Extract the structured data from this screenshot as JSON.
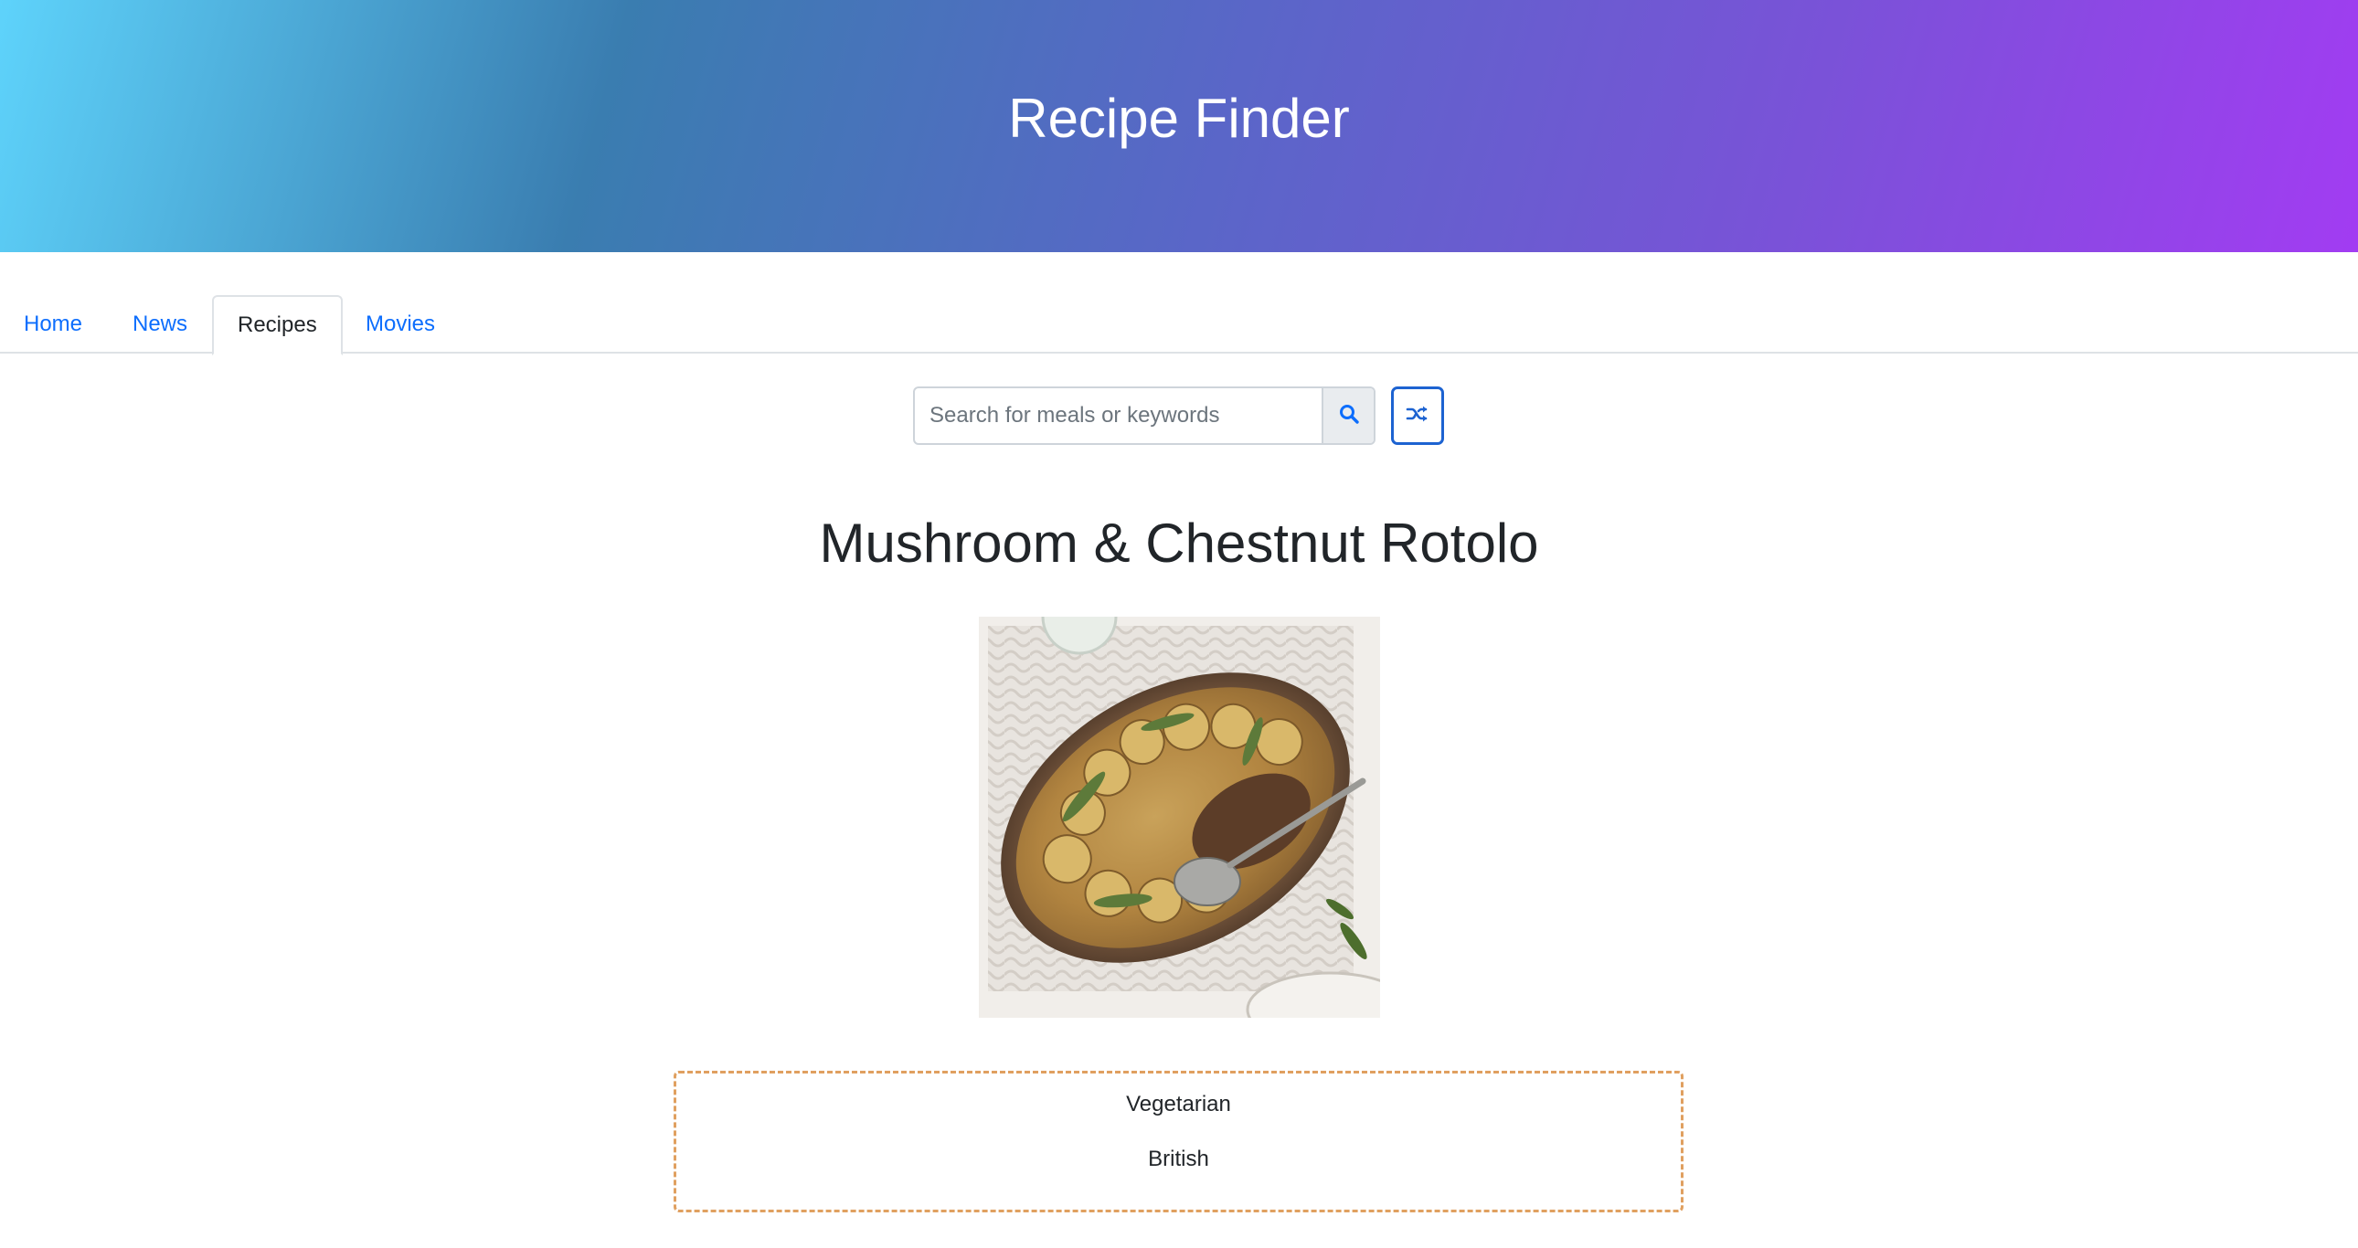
{
  "header": {
    "title": "Recipe Finder"
  },
  "tabs": [
    {
      "label": "Home",
      "active": false
    },
    {
      "label": "News",
      "active": false
    },
    {
      "label": "Recipes",
      "active": true
    },
    {
      "label": "Movies",
      "active": false
    }
  ],
  "search": {
    "placeholder": "Search for meals or keywords",
    "value": "",
    "search_icon": "search-icon",
    "random_icon": "shuffle-icon"
  },
  "meal": {
    "title": "Mushroom & Chestnut Rotolo",
    "image_alt": "Mushroom & Chestnut Rotolo",
    "category": "Vegetarian",
    "area": "British"
  },
  "colors": {
    "link": "#0d6efd",
    "random_border": "#1d63d1",
    "info_border": "#e0a060"
  }
}
